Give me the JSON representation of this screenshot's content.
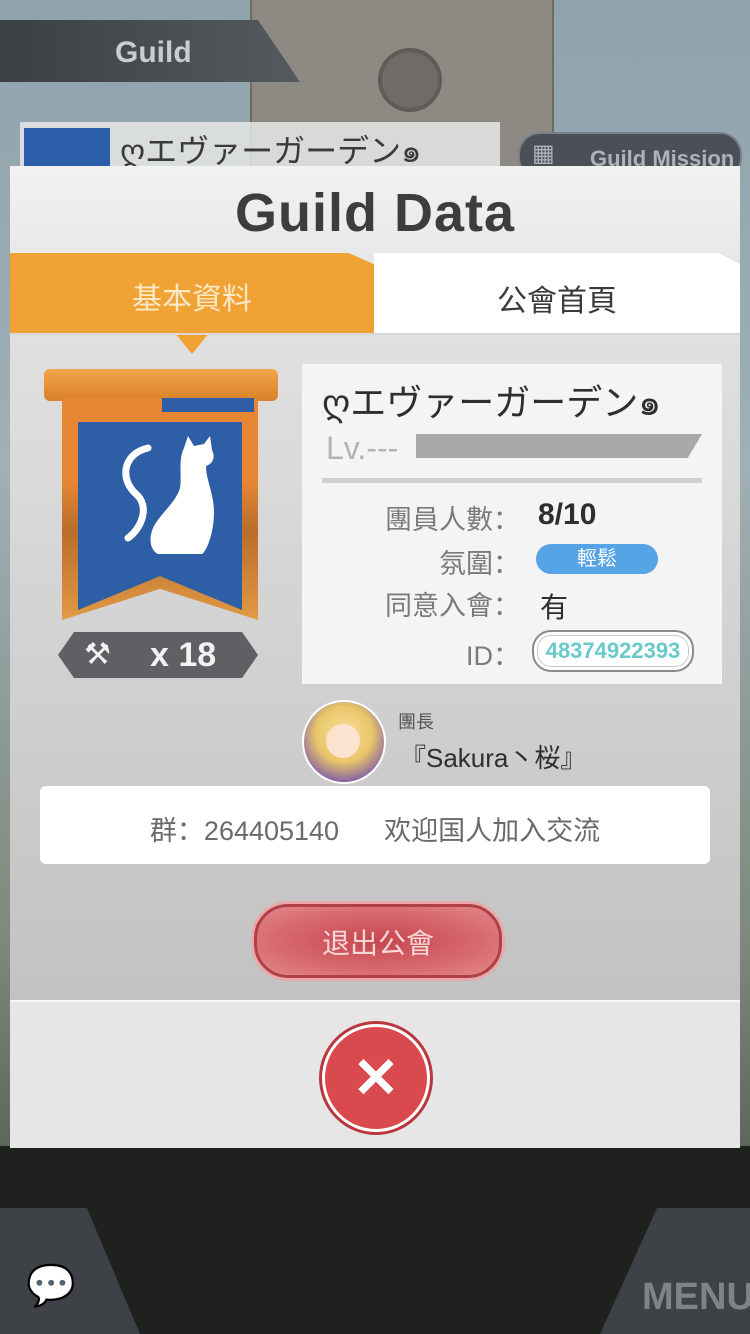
{
  "background": {
    "nav_title": "Guild",
    "guild_name": "ღエヴァーガーデン๑",
    "mission_label": "Guild Mission",
    "menu_label": "MENU"
  },
  "modal": {
    "title": "Guild Data",
    "tabs": [
      {
        "label": "基本資料",
        "active": true
      },
      {
        "label": "公會首頁",
        "active": false
      }
    ],
    "emblem": {
      "icon": "cat-icon",
      "colors": {
        "banner": "#e68633",
        "inner": "#2e5ea6"
      }
    },
    "hammer": {
      "icon": "hammer-icon",
      "count": "x 18"
    },
    "info": {
      "guild_name": "ღエヴァーガーデン๑",
      "level_label": "Lv.---",
      "members_label": "團員人數：",
      "members_value": "8/10",
      "mood_label": "氛圍：",
      "mood_value": "輕鬆",
      "approval_label": "同意入會：",
      "approval_value": "有",
      "id_label": "ID：",
      "id_value": "48374922393"
    },
    "leader": {
      "label": "團長",
      "name": "『Sakura丶桜』"
    },
    "message": "群：264405140      欢迎国人加入交流",
    "leave_button": "退出公會",
    "close_icon": "close-icon"
  },
  "colors": {
    "accent": "#f0a234",
    "mood_badge": "#56a3e6",
    "danger": "#d94a4f",
    "id_text": "#6ac9c9"
  }
}
